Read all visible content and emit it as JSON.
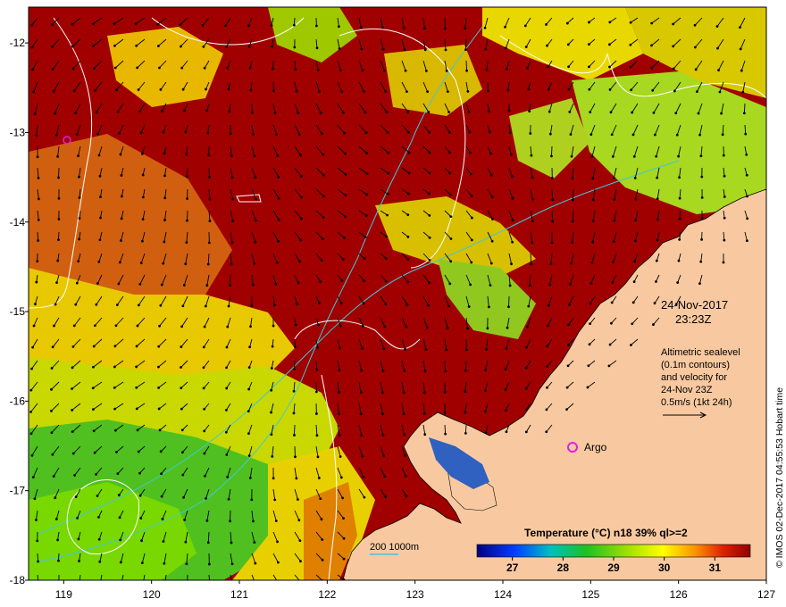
{
  "map": {
    "lon_ticks": [
      "119",
      "120",
      "121",
      "122",
      "123",
      "124",
      "125",
      "126",
      "127"
    ],
    "lat_ticks": [
      "-12",
      "-13",
      "-14",
      "-15",
      "-16",
      "-17",
      "-18"
    ],
    "lon_range": [
      118.6,
      127.0
    ],
    "lat_range": [
      -18.0,
      -11.6
    ]
  },
  "datetime": {
    "date": "24-Nov-2017",
    "time": "23:23Z"
  },
  "altimetry_note": {
    "line1": "Altimetric sealevel",
    "line2": "(0.1m contours)",
    "line3": "and velocity for",
    "line4": "24-Nov 23Z",
    "line5": "0.5m/s (1kt 24h)"
  },
  "argo_label": "Argo",
  "depth_legend": {
    "label": "200  1000m"
  },
  "colorbar": {
    "title": "Temperature (°C) n18 39% ql>=2",
    "ticks": [
      "27",
      "28",
      "29",
      "30",
      "31"
    ],
    "range": [
      26.3,
      31.7
    ]
  },
  "credit": "© IMOS 02-Dec-2017 04:55:53 Hobart time",
  "colors": {
    "land": "#f8c9a0",
    "dark_red": "#a00000",
    "contour": "#ffffff",
    "bathymetry": "#40c8d8",
    "argo_marker": "#e020e0"
  },
  "icons": [
    "argo-float-marker",
    "velocity-scale-arrow"
  ]
}
